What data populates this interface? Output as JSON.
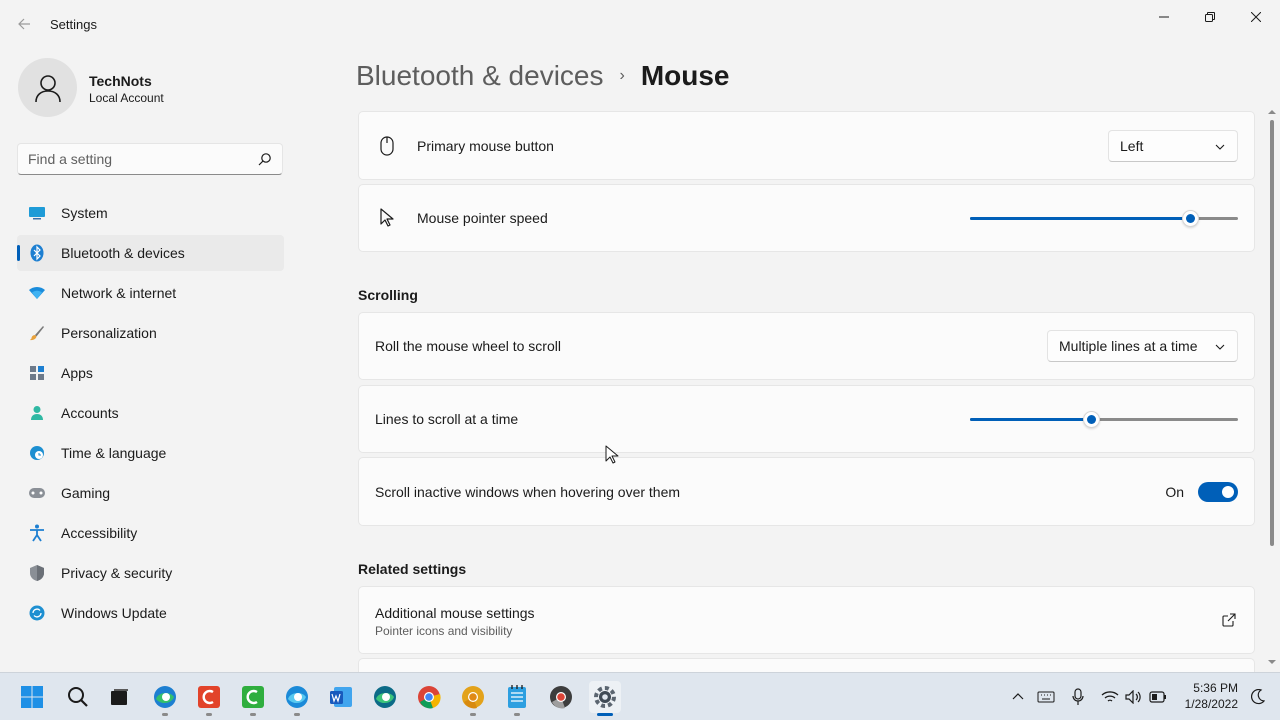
{
  "window": {
    "title": "Settings",
    "controls": [
      "minimize",
      "maximize",
      "close"
    ]
  },
  "profile": {
    "name": "TechNots",
    "account_type": "Local Account"
  },
  "search": {
    "placeholder": "Find a setting"
  },
  "sidebar": {
    "items": [
      {
        "label": "System",
        "icon": "system-icon",
        "active": false
      },
      {
        "label": "Bluetooth & devices",
        "icon": "bluetooth-icon",
        "active": true
      },
      {
        "label": "Network & internet",
        "icon": "wifi-icon",
        "active": false
      },
      {
        "label": "Personalization",
        "icon": "brush-icon",
        "active": false
      },
      {
        "label": "Apps",
        "icon": "apps-icon",
        "active": false
      },
      {
        "label": "Accounts",
        "icon": "accounts-icon",
        "active": false
      },
      {
        "label": "Time & language",
        "icon": "globe-clock-icon",
        "active": false
      },
      {
        "label": "Gaming",
        "icon": "gamepad-icon",
        "active": false
      },
      {
        "label": "Accessibility",
        "icon": "accessibility-icon",
        "active": false
      },
      {
        "label": "Privacy & security",
        "icon": "shield-icon",
        "active": false
      },
      {
        "label": "Windows Update",
        "icon": "update-icon",
        "active": false
      }
    ]
  },
  "breadcrumb": {
    "parent": "Bluetooth & devices",
    "separator": "›",
    "current": "Mouse"
  },
  "main": {
    "primary_button": {
      "label": "Primary mouse button",
      "value": "Left"
    },
    "pointer_speed": {
      "label": "Mouse pointer speed",
      "level_percent": 82
    },
    "scrolling_title": "Scrolling",
    "wheel_scroll": {
      "label": "Roll the mouse wheel to scroll",
      "value": "Multiple lines at a time"
    },
    "lines_scroll": {
      "label": "Lines to scroll at a time",
      "level_percent": 45
    },
    "inactive_scroll": {
      "label": "Scroll inactive windows when hovering over them",
      "state": "On"
    },
    "related_title": "Related settings",
    "additional": {
      "label": "Additional mouse settings",
      "sublabel": "Pointer icons and visibility"
    }
  },
  "taskbar": {
    "apps": [
      "start-icon",
      "search-icon",
      "task-view-icon",
      "edge-icon",
      "app-red-icon",
      "app-green-icon",
      "edge-beta-icon",
      "word-icon",
      "edge-dev-icon",
      "chrome-icon",
      "chrome-canary-icon",
      "notepad-icon",
      "chrome-dev-icon",
      "settings-icon"
    ],
    "time": "5:36 PM",
    "date": "1/28/2022"
  },
  "colors": {
    "accent": "#005fb8",
    "background": "#f3f3f3",
    "card": "#fbfbfb",
    "taskbar": "#dfe6ee"
  }
}
